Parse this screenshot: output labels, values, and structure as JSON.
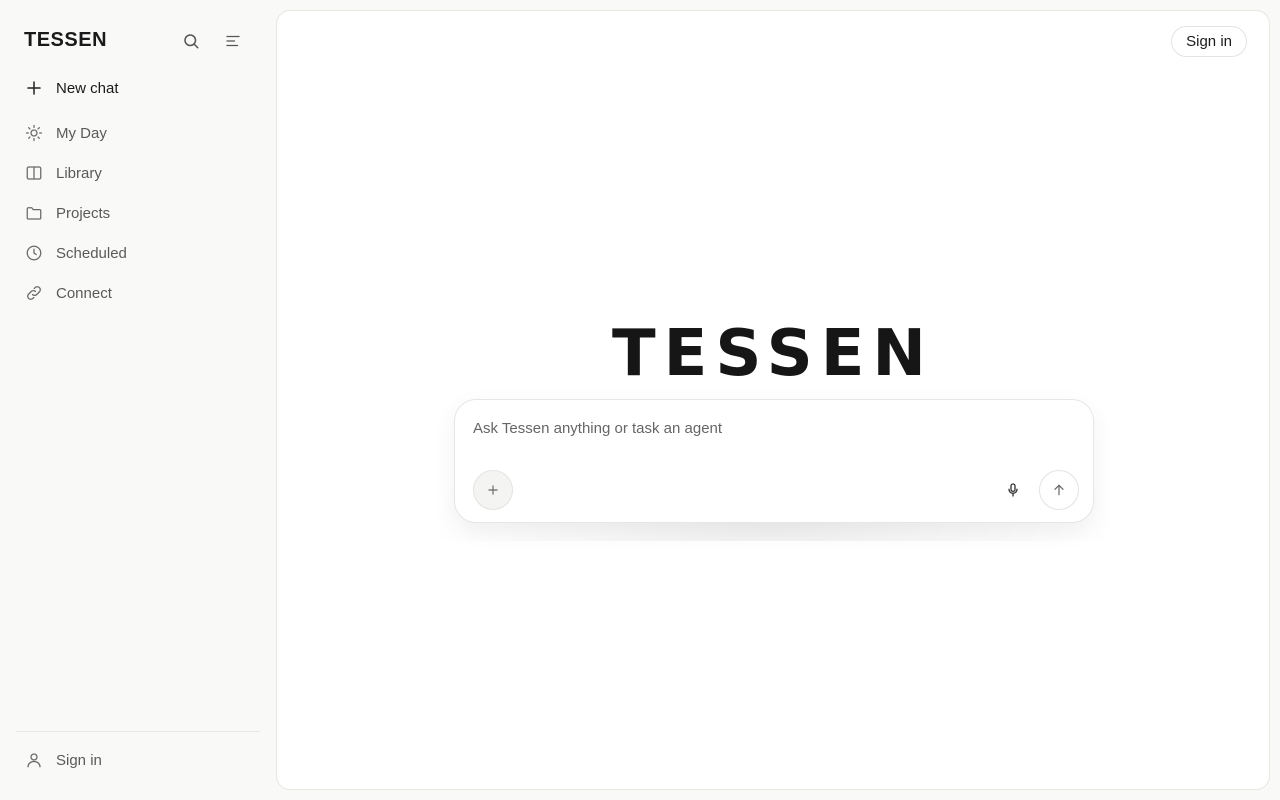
{
  "app": {
    "brand": "TESSEN",
    "hero_title": "TESSEN"
  },
  "sidebar": {
    "tools": [
      {
        "icon": "search-icon"
      },
      {
        "icon": "menu-icon"
      }
    ],
    "new_chat": {
      "label": "New chat",
      "icon": "plus-icon"
    },
    "items": [
      {
        "label": "My Day",
        "icon": "sun-icon"
      },
      {
        "label": "Library",
        "icon": "book-icon"
      },
      {
        "label": "Projects",
        "icon": "folder-icon"
      },
      {
        "label": "Scheduled",
        "icon": "clock-icon"
      },
      {
        "label": "Connect",
        "icon": "link-icon"
      }
    ],
    "footer": {
      "label": "Sign in",
      "icon": "user-icon"
    }
  },
  "header": {
    "signin_label": "Sign in"
  },
  "composer": {
    "placeholder": "Ask Tessen anything or task an agent",
    "value": "",
    "attach_icon": "plus-icon",
    "mic_icon": "microphone-icon",
    "send_icon": "arrow-up-icon"
  },
  "colors": {
    "sidebar_bg": "#f9f9f7",
    "main_bg": "#ffffff",
    "text": "#1a1a1a",
    "muted": "#5a5a5a"
  }
}
